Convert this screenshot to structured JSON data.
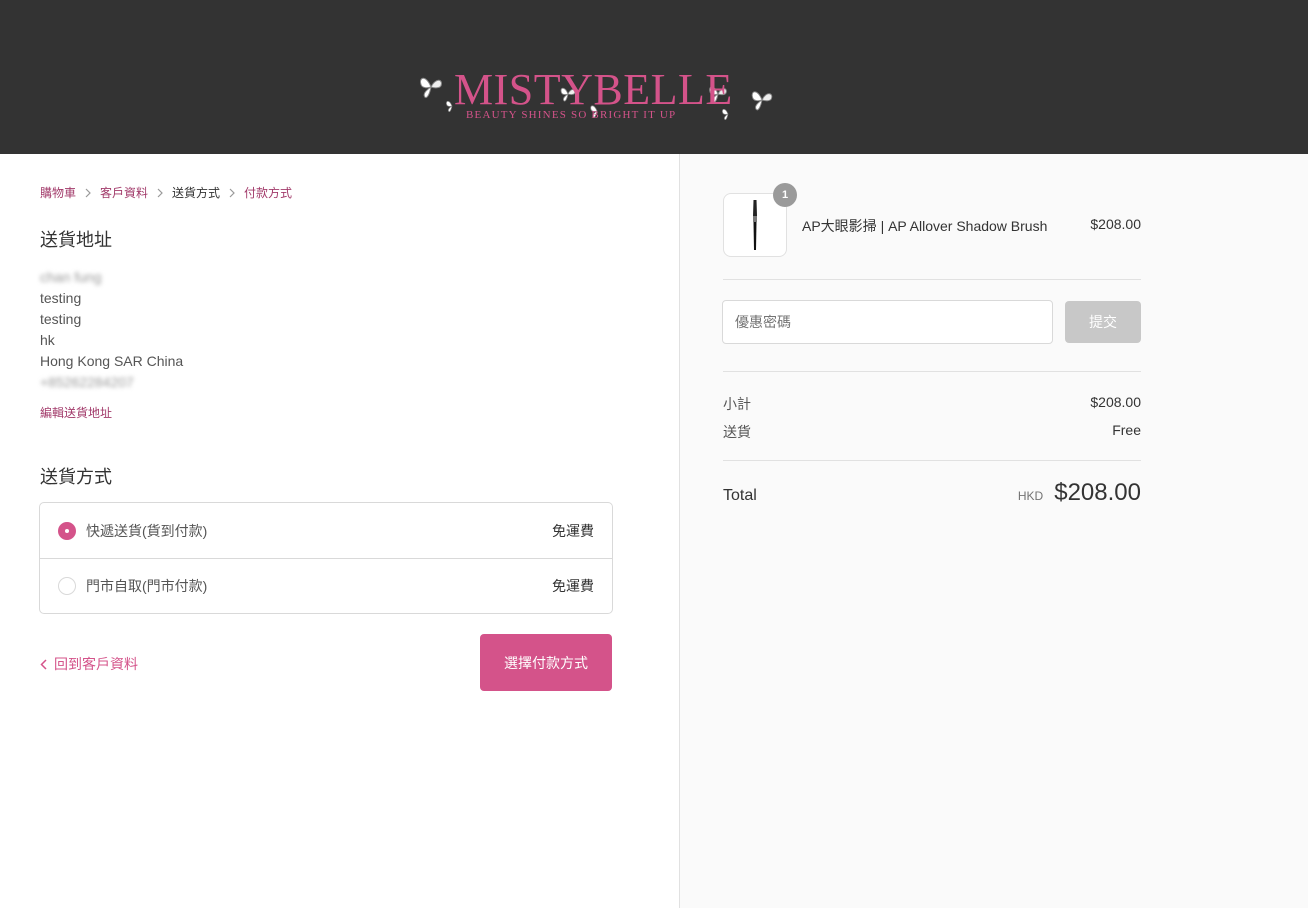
{
  "header": {
    "logo_text": "MISTYBELLE",
    "logo_tagline": "BEAUTY SHINES   SO BRIGHT IT UP",
    "background": "#333333",
    "brand_color": "#d4538a"
  },
  "breadcrumb": {
    "items": [
      {
        "label": "購物車"
      },
      {
        "label": "客戶資料"
      },
      {
        "label": "送貨方式"
      },
      {
        "label": "付款方式"
      }
    ]
  },
  "shipping_address": {
    "title": "送貨地址",
    "name": "chan fung",
    "lines": [
      "testing",
      "testing",
      "hk",
      "Hong Kong SAR China"
    ],
    "phone": "+85262284207",
    "edit_label": "編輯送貨地址"
  },
  "shipping_method": {
    "title": "送貨方式",
    "options": [
      {
        "label": "快遞送貨(貨到付款)",
        "price": "免運費",
        "selected": true
      },
      {
        "label": "門市自取(門市付款)",
        "price": "免運費",
        "selected": false
      }
    ]
  },
  "actions": {
    "back_label": "回到客戶資料",
    "continue_label": "選擇付款方式"
  },
  "order_summary": {
    "product": {
      "name": "AP大眼影掃 | AP Allover Shadow Brush",
      "price": "$208.00",
      "quantity": "1",
      "image_icon": "makeup-brush-icon"
    },
    "discount": {
      "placeholder": "優惠密碼",
      "apply_label": "提交"
    },
    "subtotal_label": "小計",
    "subtotal_value": "$208.00",
    "shipping_label": "送貨",
    "shipping_value": "Free",
    "total_label": "Total",
    "currency": "HKD",
    "total_value": "$208.00"
  }
}
